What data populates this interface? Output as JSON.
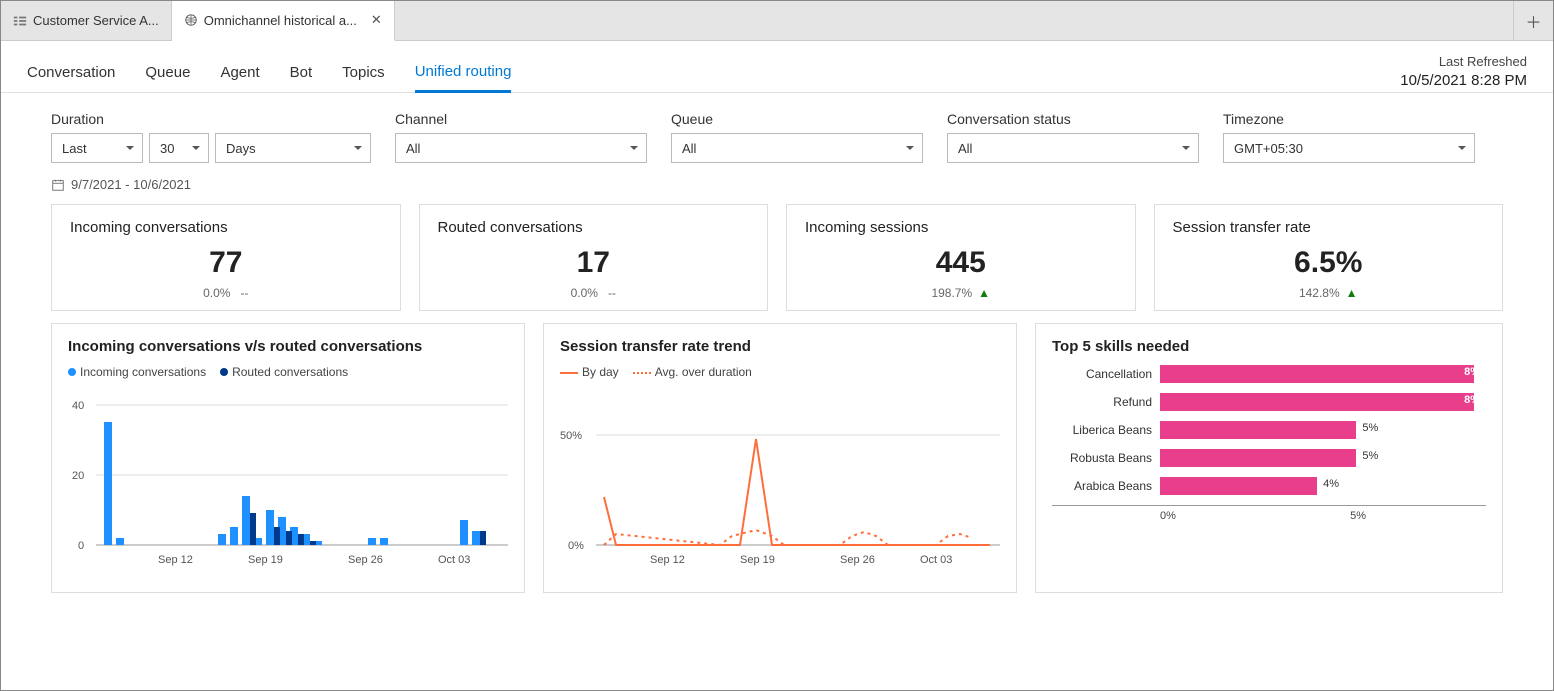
{
  "tabs": [
    {
      "label": "Customer Service A...",
      "active": false,
      "closable": false
    },
    {
      "label": "Omnichannel historical a...",
      "active": true,
      "closable": true
    }
  ],
  "subnav": {
    "items": [
      "Conversation",
      "Queue",
      "Agent",
      "Bot",
      "Topics",
      "Unified routing"
    ],
    "active_index": 5
  },
  "refresh": {
    "label": "Last Refreshed",
    "timestamp": "10/5/2021 8:28 PM"
  },
  "filters": {
    "duration": {
      "label": "Duration",
      "mode": "Last",
      "value": "30",
      "unit": "Days",
      "range_icon": "calendar",
      "range_text": "9/7/2021 - 10/6/2021"
    },
    "channel": {
      "label": "Channel",
      "value": "All"
    },
    "queue": {
      "label": "Queue",
      "value": "All"
    },
    "status": {
      "label": "Conversation status",
      "value": "All"
    },
    "timezone": {
      "label": "Timezone",
      "value": "GMT+05:30"
    }
  },
  "kpi_cards": [
    {
      "title": "Incoming conversations",
      "value": "77",
      "delta": "0.0%",
      "trend": "--"
    },
    {
      "title": "Routed conversations",
      "value": "17",
      "delta": "0.0%",
      "trend": "--"
    },
    {
      "title": "Incoming sessions",
      "value": "445",
      "delta": "198.7%",
      "trend": "up"
    },
    {
      "title": "Session transfer rate",
      "value": "6.5%",
      "delta": "142.8%",
      "trend": "up"
    }
  ],
  "chart_data": [
    {
      "type": "bar",
      "title": "Incoming conversations v/s routed conversations",
      "legend": [
        "Incoming conversations",
        "Routed conversations"
      ],
      "x_ticks": [
        "Sep 12",
        "Sep 19",
        "Sep 26",
        "Oct 03"
      ],
      "ylim": [
        0,
        40
      ],
      "y_ticks": [
        0,
        20,
        40
      ],
      "series": [
        {
          "name": "Incoming conversations",
          "color": "#1e90ff",
          "categories": [
            "Sep 08",
            "Sep 09",
            "Sep 15",
            "Sep 16",
            "Sep 17",
            "Sep 18",
            "Sep 19",
            "Sep 20",
            "Sep 21",
            "Sep 22",
            "Sep 23",
            "Sep 28",
            "Sep 29",
            "Oct 04",
            "Oct 05"
          ],
          "values": [
            35,
            2,
            3,
            5,
            14,
            2,
            10,
            8,
            5,
            3,
            1,
            2,
            2,
            7,
            4
          ]
        },
        {
          "name": "Routed conversations",
          "color": "#003a8c",
          "categories": [
            "Sep 17",
            "Sep 19",
            "Sep 20",
            "Sep 21",
            "Sep 22",
            "Oct 05"
          ],
          "values": [
            9,
            5,
            4,
            3,
            1,
            4
          ]
        }
      ]
    },
    {
      "type": "line",
      "title": "Session transfer rate trend",
      "legend": [
        "By day",
        "Avg. over duration"
      ],
      "x_ticks": [
        "Sep 12",
        "Sep 19",
        "Sep 26",
        "Oct 03"
      ],
      "ylabel_format": "percent",
      "ylim": [
        0,
        60
      ],
      "y_ticks": [
        0,
        50
      ],
      "series": [
        {
          "name": "By day",
          "style": "solid",
          "color": "#ff6d3b",
          "x": [
            "Sep 08",
            "Sep 09",
            "Sep 10",
            "Sep 18",
            "Sep 19",
            "Sep 20",
            "Sep 21",
            "Oct 06"
          ],
          "y": [
            22,
            0,
            0,
            0,
            48,
            0,
            0,
            0
          ]
        },
        {
          "name": "Avg. over duration",
          "style": "dotted",
          "color": "#ff6d3b",
          "x": [
            "Sep 08",
            "Sep 09",
            "Sep 17",
            "Sep 18",
            "Sep 19",
            "Sep 20",
            "Sep 21",
            "Sep 22",
            "Sep 25",
            "Sep 26",
            "Sep 27",
            "Sep 28",
            "Sep 29",
            "Oct 02",
            "Oct 03",
            "Oct 04",
            "Oct 05"
          ],
          "y": [
            0,
            5,
            0,
            4,
            7,
            4,
            0,
            0,
            0,
            4,
            6,
            4,
            0,
            0,
            4,
            5,
            3
          ]
        }
      ]
    },
    {
      "type": "bar",
      "orientation": "horizontal",
      "title": "Top 5 skills needed",
      "categories": [
        "Cancellation",
        "Refund",
        "Liberica Beans",
        "Robusta Beans",
        "Arabica Beans"
      ],
      "values": [
        8,
        8,
        5,
        5,
        4
      ],
      "value_format": "percent",
      "xlim": [
        0,
        8.3
      ],
      "x_ticks": [
        "0%",
        "5%"
      ],
      "bar_color": "#e83e8c"
    }
  ]
}
